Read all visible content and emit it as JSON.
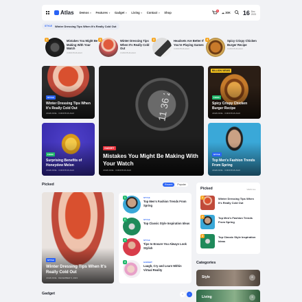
{
  "header": {
    "logo": "Atlas",
    "nav": [
      "Demos",
      "Features",
      "Gadget",
      "Living",
      "Contact",
      "Shop"
    ],
    "cart_count": "0",
    "weather": "30K",
    "date_day": "16",
    "date_month": "Dec",
    "date_year": "2023"
  },
  "ticker": {
    "tag": "STYLE",
    "text": "Winter Dressing Tips When It's Really Cold Out"
  },
  "trending": [
    {
      "num": "1",
      "title": "Mistakes You Might Be Making With Your Watch",
      "meta": "3 MONTHS AGO"
    },
    {
      "num": "2",
      "title": "Winter Dressing Tips When It's Really Cold Out",
      "meta": "3 MONTHS AGO"
    },
    {
      "num": "3",
      "title": "Headsets Are Better If You're Playing Games",
      "meta": "3 MONTHS AGO"
    },
    {
      "num": "4",
      "title": "Spicy Crispy Chicken Burger Recipe",
      "meta": "3 MONTHS AGO"
    }
  ],
  "grid": {
    "c1": {
      "cat": "STYLE",
      "title": "Winter Dressing Tips When It's Really Cold Out",
      "meta": "JOHN DOE · 3 MONTHS AGO"
    },
    "c2": {
      "cat": "FOOD",
      "title": "Surprising Benefits of Honeydew Melon",
      "meta": "JOHN DOE · 3 MONTHS AGO"
    },
    "big": {
      "cat": "GADGET",
      "title": "Mistakes You Might Be Making With Your Watch",
      "meta": "JOHN DOE · 3 MONTHS AGO",
      "watch_text": "11 36 21"
    },
    "c3": {
      "cat": "FOOD",
      "title": "Spicy Crispy Chicken Burger Recipe",
      "meta": "JOHN DOE · 3 MONTHS AGO",
      "badge": "BILLION VIEWS"
    },
    "c4": {
      "cat": "STYLE",
      "title": "Top Men's Fashion Trends From Spring",
      "meta": "JOHN DOE · 3 MONTHS AGO"
    }
  },
  "picked": {
    "title": "Picked",
    "tabs": [
      "Recent",
      "Popular"
    ],
    "feature": {
      "cat": "STYLE",
      "title": "Winter Dressing Tips When It's Really Cold Out",
      "meta": "JOHN DOE · DECEMBER 5, 2023"
    },
    "list": [
      {
        "num": "1",
        "cat": "STYLE",
        "title": "Top Men's Fashion Trends From Spring"
      },
      {
        "num": "2",
        "cat": "STYLE",
        "title": "Top Classic Style Inspiration Ideas"
      },
      {
        "num": "3",
        "cat": "STYLE",
        "title": "Tips to Ensure You Always Look Stylish"
      },
      {
        "num": "4",
        "cat": "GADGET",
        "title": "Laugh, Cry and Learn Within Virtual Reality"
      }
    ]
  },
  "sidebar": {
    "title": "Picked",
    "view_all": "VIEW ALL",
    "items": [
      {
        "num": "1",
        "title": "Winter Dressing Tips When It's Really Cold Out"
      },
      {
        "num": "2",
        "title": "Top Men's Fashion Trends From Spring"
      },
      {
        "num": "3",
        "title": "Top Classic Style Inspiration Ideas"
      }
    ]
  },
  "categories": {
    "title": "Categories",
    "items": [
      {
        "label": "Style",
        "count": "8"
      },
      {
        "label": "Living",
        "count": "3"
      }
    ]
  },
  "gadget": {
    "title": "Gadget",
    "pages": [
      "1",
      "2"
    ]
  }
}
